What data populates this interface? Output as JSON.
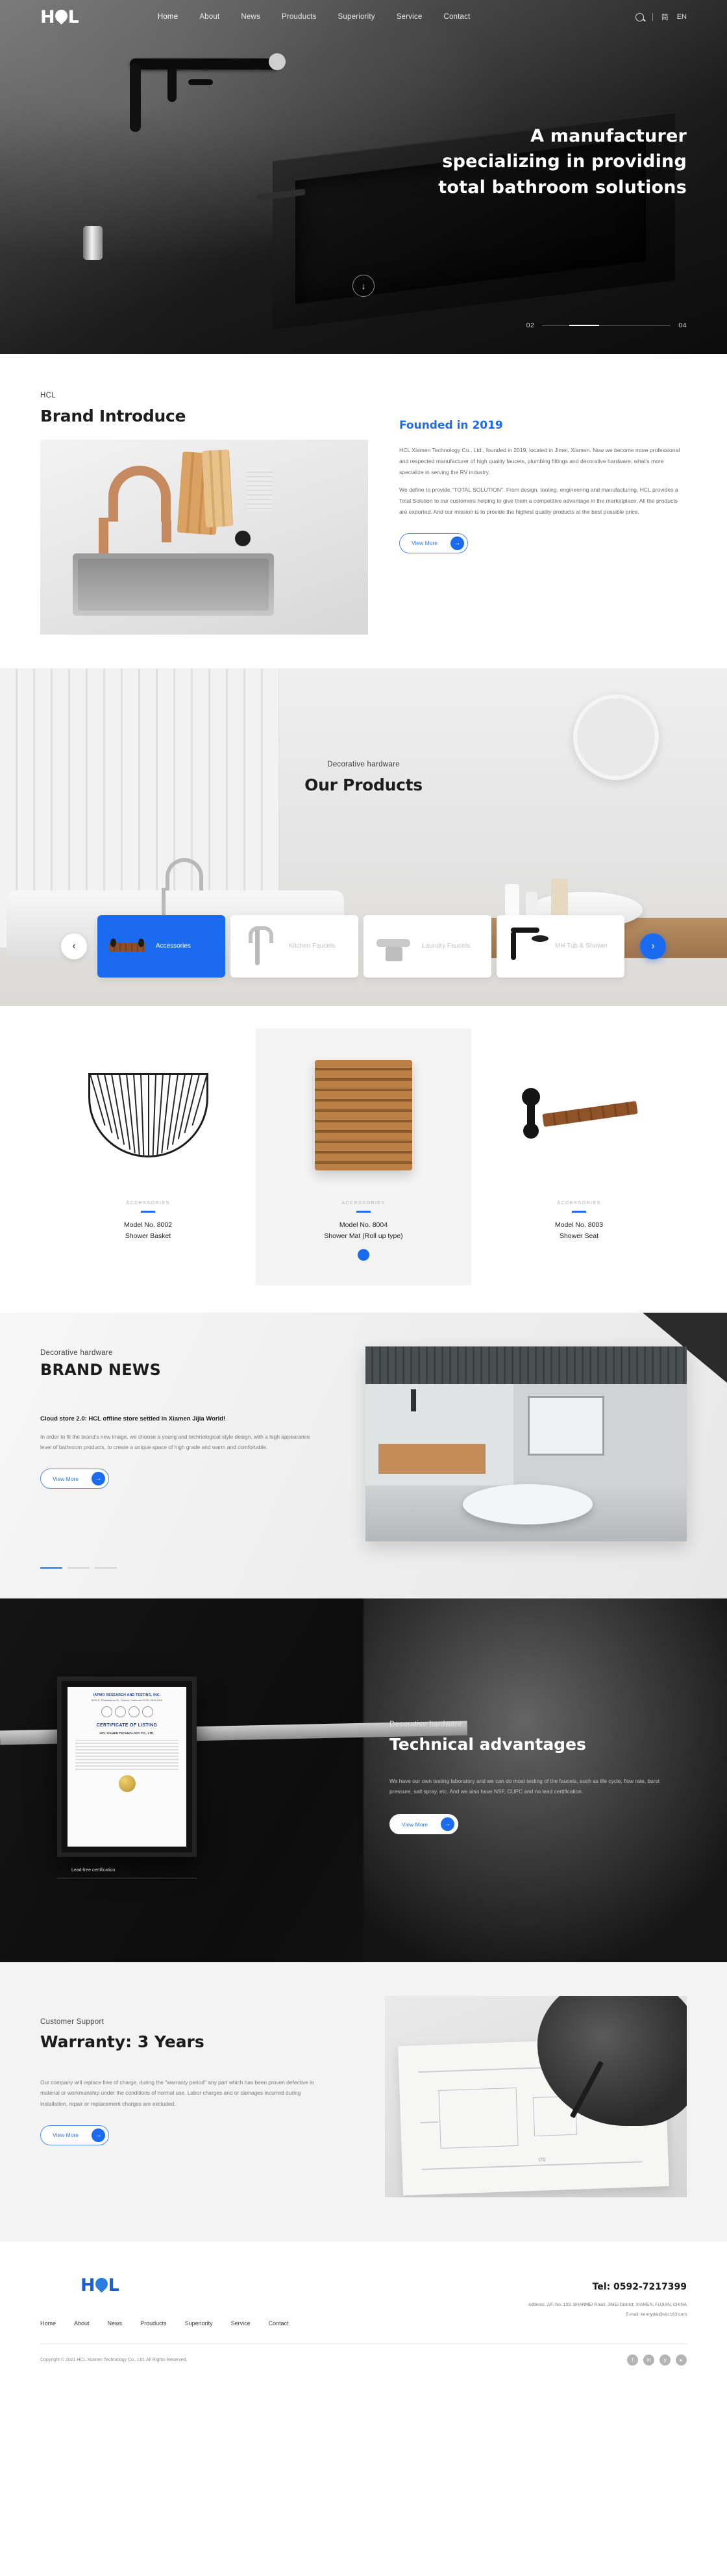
{
  "brand": {
    "name": "HCL"
  },
  "header": {
    "nav": [
      {
        "label": "Home",
        "active": true
      },
      {
        "label": "About"
      },
      {
        "label": "News"
      },
      {
        "label": "Prouducts"
      },
      {
        "label": "Superiority"
      },
      {
        "label": "Service"
      },
      {
        "label": "Contact"
      }
    ],
    "search_icon": "search-icon",
    "lang_cn": "简",
    "lang_en": "EN"
  },
  "hero": {
    "headline_line1": "A manufacturer",
    "headline_line2": "specializing in providing",
    "headline_line3": "total bathroom solutions",
    "scroll_icon": "↓",
    "slide_current": "02",
    "slide_total": "04"
  },
  "brand_intro": {
    "eyebrow": "HCL",
    "title": "Brand Introduce",
    "subtitle": "Founded in 2019",
    "paragraph1": "HCL Xiamen Technology Co., Ltd., founded in 2019, located in Jimei, Xiamen. Now we become more professional and respected manufacturer of high quality faucets, plumbing fittings and decorative hardware, what's more specialize in serving the RV industry.",
    "paragraph2": "We define to provide \"TOTAL SOLUTION\". From design, tooling, engineering and manufacturing, HCL provides a Total Solution to our customers helping to give them a competitive advantage in the marketplace. All the products are exported. And our mission is to provide the highest quality products at the best possible price.",
    "cta": "View More",
    "cta_icon": "arrow-right-icon"
  },
  "products": {
    "eyebrow": "Decorative hardware",
    "title": "Our Products",
    "prev_icon": "chevron-left-icon",
    "next_icon": "chevron-right-icon",
    "tabs": [
      {
        "label": "Accessories",
        "active": true,
        "thumb": "shelf-icon"
      },
      {
        "label": "Kitchen Faucets",
        "active": false,
        "thumb": "kitchen-faucet-icon"
      },
      {
        "label": "Laundry Faucets",
        "active": false,
        "thumb": "laundry-faucet-icon"
      },
      {
        "label": "MH Tub & Shower",
        "active": false,
        "thumb": "showerhead-icon"
      }
    ],
    "items": [
      {
        "category": "ACCESSORIES",
        "model": "Model No. 8002",
        "name": "Shower Basket",
        "highlight": false
      },
      {
        "category": "ACCESSORIES",
        "model": "Model No. 8004",
        "name": "Shower Mat (Roll up type)",
        "highlight": true
      },
      {
        "category": "ACCESSORIES",
        "model": "Model No. 8003",
        "name": "Shower Seat",
        "highlight": false
      }
    ]
  },
  "news": {
    "eyebrow": "Decorative hardware",
    "title": "BRAND NEWS",
    "headline": "Cloud store 2.0: HCL offline store settled in Xiamen Jijia World!",
    "body": "In order to fit the brand's new image, we choose a young and technological style design, with a high appearance level of bathroom products, to create a unique space of high grade and warm and comfortable.",
    "cta": "View More",
    "cta_icon": "arrow-right-icon"
  },
  "tech": {
    "eyebrow": "Decorative hardware",
    "title": "Technical advantages",
    "body": "We have our own testing laboratory and we can do most testing of the faucets, such as life cycle, flow rate, burst pressure, salt spray, etc. And we also have NSF, CUPC and no lead certification.",
    "cta": "View More",
    "cta_icon": "arrow-right-icon",
    "certificate": {
      "org": "IAPMO RESEARCH AND TESTING, INC.",
      "org_sub": "5001 E. Philadelphia St., Ontario, California 91761-2816  USA",
      "title": "CERTIFICATE OF LISTING",
      "company": "HCL XIAMEN TECHNOLOGY CO., LTD."
    },
    "caption": "Lead-free certification"
  },
  "warranty": {
    "eyebrow": "Customer Support",
    "title": "Warranty: 3 Years",
    "body": "Our company will replace free of charge, during the \"warranty period\" any part which has been proven defective in material or workmanship under the conditions of normal use. Labor charges and or damages incurred during installation, repair or replacement charges are excluded.",
    "cta": "View More",
    "cta_icon": "arrow-right-icon",
    "drawing_label": "t70"
  },
  "footer": {
    "nav": [
      "Home",
      "About",
      "News",
      "Prouducts",
      "Superiority",
      "Service",
      "Contact"
    ],
    "tel": "Tel: 0592-7217399",
    "address": "Address: 2/F, No. 133, SHANMEI Road, JIMEI District, XIAMEN, FUJIAN, CHINA",
    "email": "E-mail: kennydai@vip.163.com",
    "copyright": "Copyright © 2021 HCL Xiamen Technology Co., Ltd. All Rights Reserved.",
    "social": [
      {
        "icon": "facebook-icon",
        "glyph": "f"
      },
      {
        "icon": "linkedin-icon",
        "glyph": "in"
      },
      {
        "icon": "twitter-icon",
        "glyph": "y"
      },
      {
        "icon": "youtube-icon",
        "glyph": "▸"
      }
    ]
  },
  "colors": {
    "accent": "#1a6bf0",
    "dark": "#1a1a1a",
    "muted": "#7a7a7a"
  }
}
